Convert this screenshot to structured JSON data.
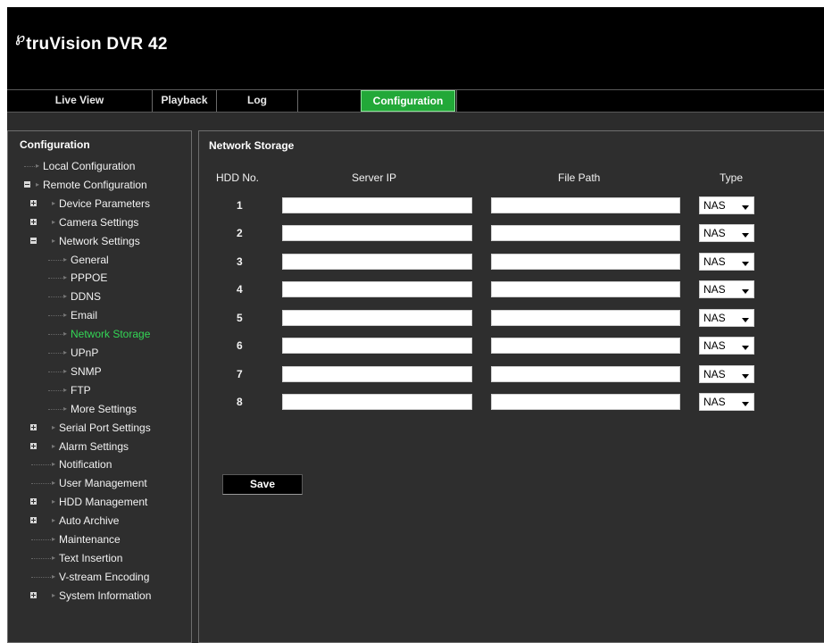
{
  "app": {
    "logo_mark": "℘",
    "logo_text": "truVision  DVR 42"
  },
  "tabs": [
    {
      "label": "Live View",
      "active": false
    },
    {
      "label": "Playback",
      "active": false
    },
    {
      "label": "Log",
      "active": false
    },
    {
      "label": "Configuration",
      "active": true
    }
  ],
  "sidebar": {
    "title": "Configuration",
    "items": [
      {
        "label": "Local Configuration",
        "level": 0,
        "expander": "none",
        "selected": false
      },
      {
        "label": "Remote Configuration",
        "level": 0,
        "expander": "minus",
        "selected": false
      },
      {
        "label": "Device Parameters",
        "level": 1,
        "expander": "plus",
        "selected": false
      },
      {
        "label": "Camera Settings",
        "level": 1,
        "expander": "plus",
        "selected": false
      },
      {
        "label": "Network Settings",
        "level": 1,
        "expander": "minus",
        "selected": false
      },
      {
        "label": "General",
        "level": 2,
        "expander": "none",
        "selected": false
      },
      {
        "label": "PPPOE",
        "level": 2,
        "expander": "none",
        "selected": false
      },
      {
        "label": "DDNS",
        "level": 2,
        "expander": "none",
        "selected": false
      },
      {
        "label": "Email",
        "level": 2,
        "expander": "none",
        "selected": false
      },
      {
        "label": "Network Storage",
        "level": 2,
        "expander": "none",
        "selected": true
      },
      {
        "label": "UPnP",
        "level": 2,
        "expander": "none",
        "selected": false
      },
      {
        "label": "SNMP",
        "level": 2,
        "expander": "none",
        "selected": false
      },
      {
        "label": "FTP",
        "level": 2,
        "expander": "none",
        "selected": false
      },
      {
        "label": "More Settings",
        "level": 2,
        "expander": "none",
        "selected": false
      },
      {
        "label": "Serial Port Settings",
        "level": 1,
        "expander": "plus",
        "selected": false
      },
      {
        "label": "Alarm Settings",
        "level": 1,
        "expander": "plus",
        "selected": false
      },
      {
        "label": "Notification",
        "level": 1,
        "expander": "none",
        "selected": false
      },
      {
        "label": "User Management",
        "level": 1,
        "expander": "none",
        "selected": false
      },
      {
        "label": "HDD Management",
        "level": 1,
        "expander": "plus",
        "selected": false
      },
      {
        "label": "Auto Archive",
        "level": 1,
        "expander": "plus",
        "selected": false
      },
      {
        "label": "Maintenance",
        "level": 1,
        "expander": "none",
        "selected": false
      },
      {
        "label": "Text Insertion",
        "level": 1,
        "expander": "none",
        "selected": false
      },
      {
        "label": "V-stream Encoding",
        "level": 1,
        "expander": "none",
        "selected": false
      },
      {
        "label": "System Information",
        "level": 1,
        "expander": "plus",
        "selected": false
      }
    ]
  },
  "main": {
    "title": "Network Storage",
    "columns": {
      "hdd_no": "HDD No.",
      "server_ip": "Server IP",
      "file_path": "File Path",
      "type": "Type"
    },
    "rows": [
      {
        "hdd": "1",
        "server_ip": "",
        "file_path": "",
        "type": "NAS"
      },
      {
        "hdd": "2",
        "server_ip": "",
        "file_path": "",
        "type": "NAS"
      },
      {
        "hdd": "3",
        "server_ip": "",
        "file_path": "",
        "type": "NAS"
      },
      {
        "hdd": "4",
        "server_ip": "",
        "file_path": "",
        "type": "NAS"
      },
      {
        "hdd": "5",
        "server_ip": "",
        "file_path": "",
        "type": "NAS"
      },
      {
        "hdd": "6",
        "server_ip": "",
        "file_path": "",
        "type": "NAS"
      },
      {
        "hdd": "7",
        "server_ip": "",
        "file_path": "",
        "type": "NAS"
      },
      {
        "hdd": "8",
        "server_ip": "",
        "file_path": "",
        "type": "NAS"
      }
    ],
    "save_label": "Save"
  },
  "colors": {
    "active_tab": "#22a838",
    "selected_item": "#33d655",
    "panel_bg": "#2e2e2e",
    "header_bg": "#000000"
  }
}
